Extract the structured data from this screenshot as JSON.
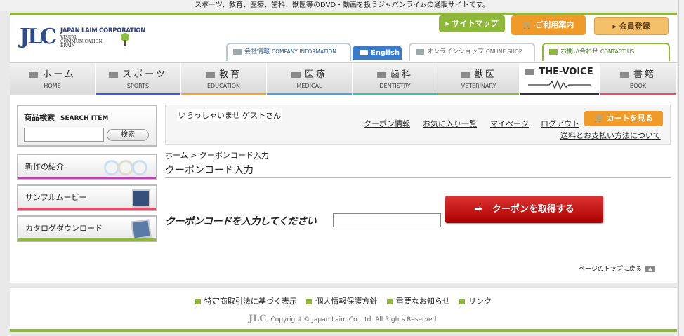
{
  "top_note": "スポーツ、教育、医療、歯科、獣医等のDVD・動画を扱うジャパンライムの通販サイトです。",
  "logo": {
    "mark": "JLC",
    "company": "JAPAN LAIM CORPORATION",
    "tagline": "VISUAL COMMUNICATION BRAIN"
  },
  "header_buttons": {
    "sitemap": "サイトマップ",
    "guide": "ご利用案内",
    "register": "会員登録"
  },
  "header_tabs": {
    "company": {
      "jp": "会社情報",
      "en": "COMPANY INFORMATION"
    },
    "english": "English",
    "shop": {
      "jp": "オンラインショップ",
      "en": "ONLINE SHOP"
    },
    "contact": {
      "jp": "お問い合わせ",
      "en": "CONTACT US"
    }
  },
  "nav": [
    {
      "jp": "ホーム",
      "en": "HOME",
      "color": "#dddddd"
    },
    {
      "jp": "スポーツ",
      "en": "SPORTS",
      "color": "#3a5ad8"
    },
    {
      "jp": "教育",
      "en": "EDUCATION",
      "color": "#f2a32a"
    },
    {
      "jp": "医療",
      "en": "MEDICAL",
      "color": "#4aa0e0"
    },
    {
      "jp": "歯科",
      "en": "DENTISTRY",
      "color": "#3ac0a8"
    },
    {
      "jp": "獣医",
      "en": "VETERINARY",
      "color": "#8db83a"
    },
    {
      "jp": "THE-VOICE",
      "en": "",
      "color": "#333333"
    },
    {
      "jp": "書籍",
      "en": "BOOK",
      "color": "#e84a6a"
    }
  ],
  "search": {
    "title": "商品検索",
    "title_en": "SEARCH ITEM",
    "button": "検索",
    "value": ""
  },
  "sidebar": {
    "new": "新作の紹介",
    "movie": "サンプルムービー",
    "catalog": "カタログダウンロード"
  },
  "account": {
    "welcome": "いらっしゃいませ ゲストさん",
    "links": [
      "クーポン情報",
      "お気に入り一覧",
      "マイページ",
      "ログアウト"
    ],
    "cart": "カートを見る",
    "shipping": "送料とお支払い方法について"
  },
  "breadcrumb": {
    "home": "ホーム",
    "sep": " > ",
    "current": "クーポンコード入力"
  },
  "page_title": "クーポンコード入力",
  "coupon": {
    "label": "クーポンコードを入力してください",
    "value": "",
    "button": "クーポンを取得する"
  },
  "page_top": "ページのトップに戻る",
  "footer": {
    "links": [
      "特定商取引法に基づく表示",
      "個人情報保護方針",
      "重要なお知らせ",
      "リンク"
    ],
    "copyright": "Copyright © Japan Laim Co.,Ltd. All Rights Reserved."
  }
}
